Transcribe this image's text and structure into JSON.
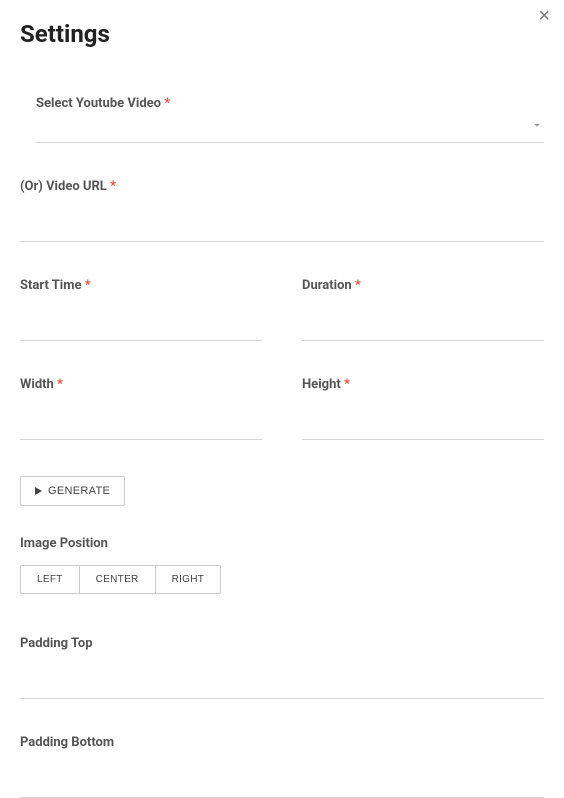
{
  "title": "Settings",
  "close_glyph": "×",
  "fields": {
    "select_video": {
      "label": "Select Youtube Video",
      "value": ""
    },
    "video_url": {
      "label": "(Or) Video URL",
      "value": ""
    },
    "start_time": {
      "label": "Start Time",
      "value": ""
    },
    "duration": {
      "label": "Duration",
      "value": ""
    },
    "width": {
      "label": "Width",
      "value": ""
    },
    "height": {
      "label": "Height",
      "value": ""
    },
    "padding_top": {
      "label": "Padding Top",
      "value": ""
    },
    "padding_bottom": {
      "label": "Padding Bottom",
      "value": ""
    }
  },
  "generate_button": "GENERATE",
  "image_position": {
    "label": "Image Position",
    "options": {
      "left": "LEFT",
      "center": "CENTER",
      "right": "RIGHT"
    }
  },
  "required_mark": " *"
}
